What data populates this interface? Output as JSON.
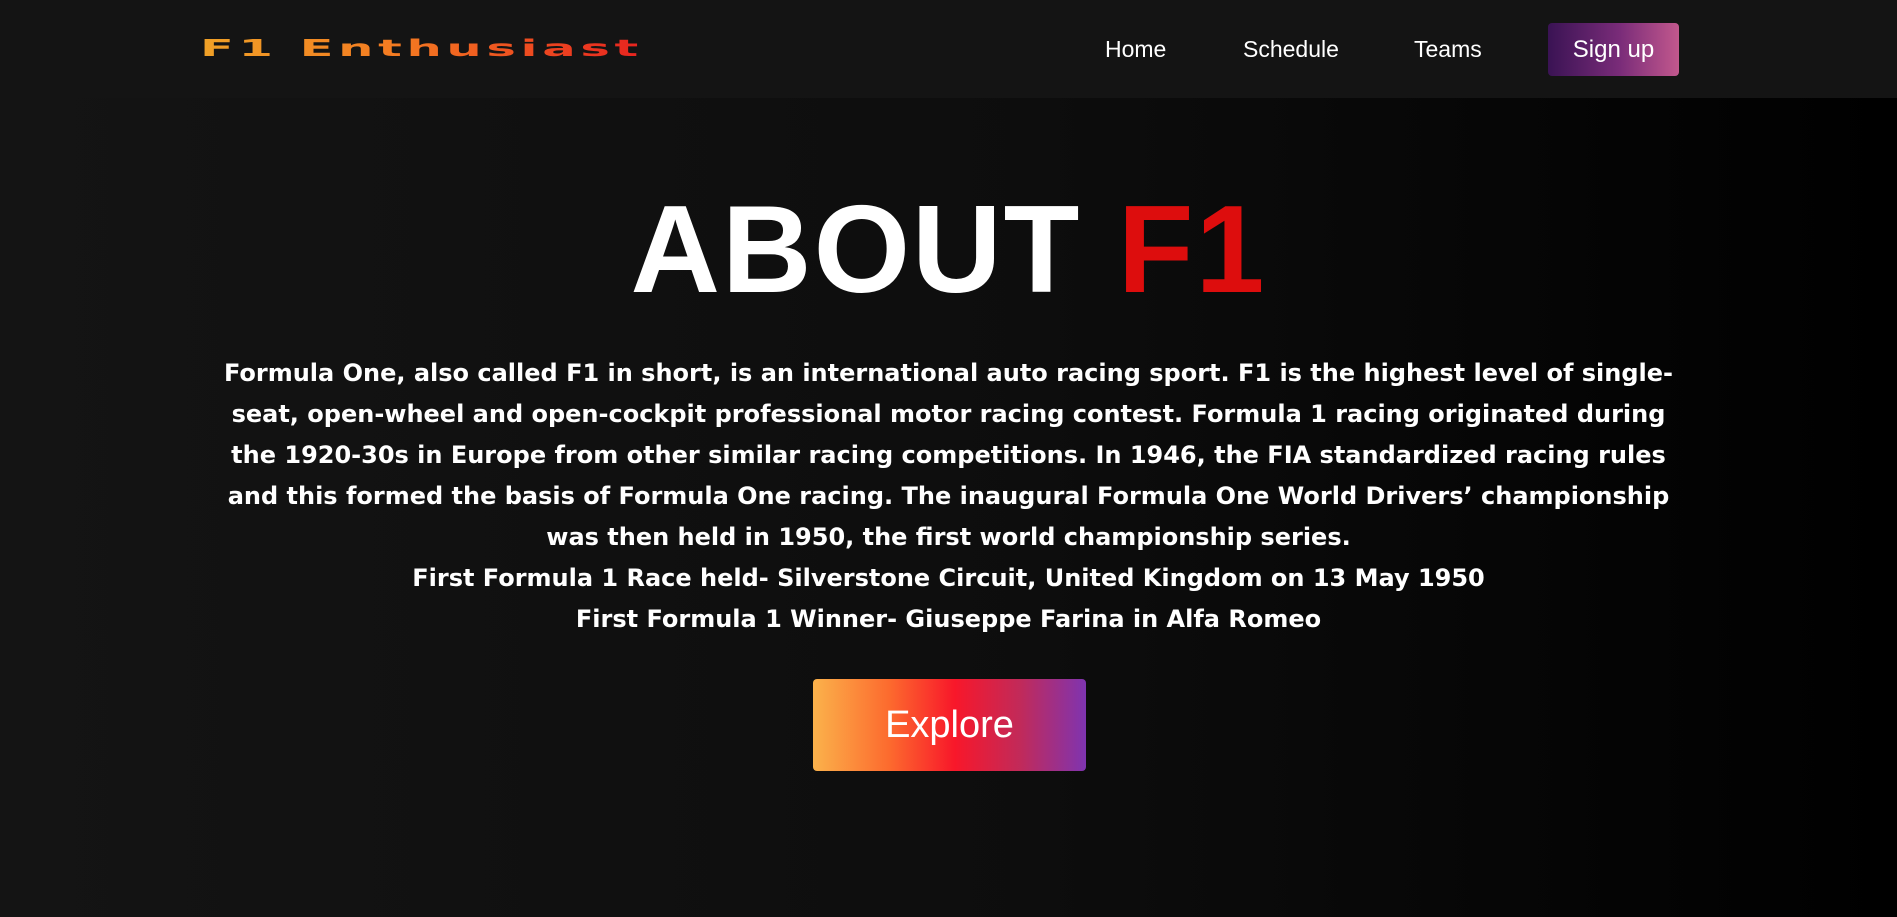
{
  "navbar": {
    "logo": "F1 Enthusiast",
    "links": [
      "Home",
      "Schedule",
      "Teams"
    ],
    "signup_label": "Sign up"
  },
  "hero": {
    "title_main": "ABOUT",
    "title_accent": "F1",
    "paragraph": "Formula One, also called F1 in short, is an international auto racing sport. F1 is the highest level of single-seat, open-wheel and open-cockpit professional motor racing contest. Formula 1 racing originated during the 1920-30s in Europe from other similar racing competitions. In 1946, the FIA standardized racing rules and this formed the basis of Formula One racing. The inaugural Formula One World Drivers’ championship was then held in 1950, the first world championship series.",
    "first_race": "First Formula 1 Race held- Silverstone Circuit, United Kingdom on 13 May 1950",
    "first_winner": "First Formula 1 Winner- Giuseppe Farina in Alfa Romeo",
    "explore_label": "Explore"
  },
  "colors": {
    "background": "#111111",
    "navbar": "#141414",
    "accent_red": "#dd0d0d",
    "logo_gradient_start": "#f0a127",
    "logo_gradient_end": "#e8231f",
    "signup_gradient_start": "#3a1354",
    "signup_gradient_end": "#c2588d"
  }
}
